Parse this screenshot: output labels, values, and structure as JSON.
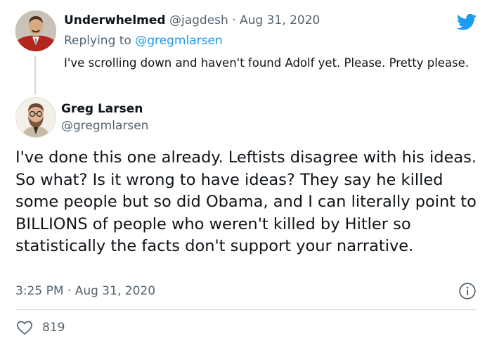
{
  "reply_tweet": {
    "display_name": "Underwhelmed",
    "handle": "@jagdesh",
    "separator": "·",
    "date": "Aug 31, 2020",
    "replying_label": "Replying to",
    "replying_to": "@gregmlarsen",
    "text": "I've scrolling down and haven't found Adolf yet. Please. Pretty please."
  },
  "main_tweet": {
    "display_name": "Greg Larsen",
    "handle": "@gregmlarsen",
    "text": "I've done this one already. Leftists disagree with his ideas. So what? Is it wrong to have ideas? They say he killed some people but so did Obama, and I can literally point to BILLIONS of people who weren't killed by Hitler so statistically the facts don't support your narrative.",
    "timestamp": "3:25 PM · Aug 31, 2020",
    "like_count": "819"
  },
  "icons": {
    "brand": "twitter-bird-icon",
    "info": "info-icon",
    "like": "heart-icon"
  },
  "colors": {
    "brand_blue": "#1d9bf0",
    "text_primary": "#0f1419",
    "text_muted": "#536471",
    "divider": "#cfd9de"
  }
}
